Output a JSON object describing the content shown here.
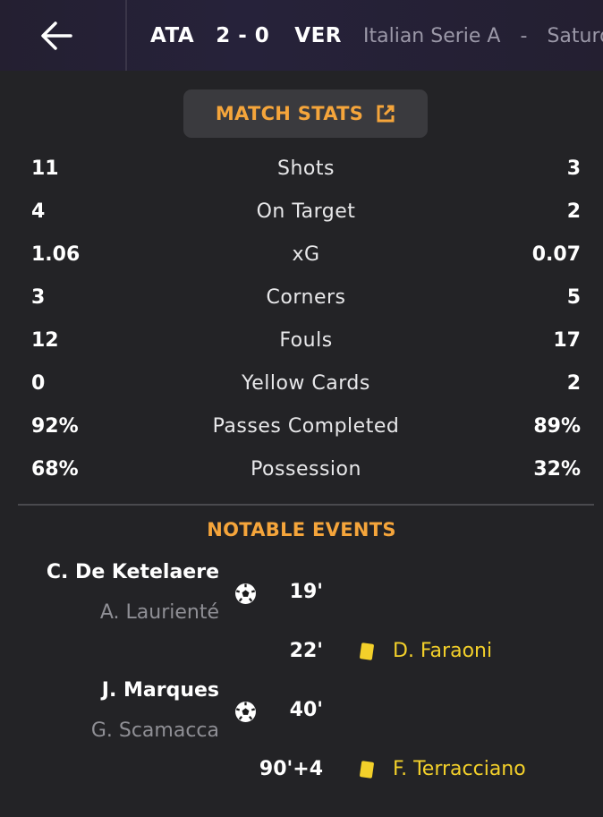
{
  "header": {
    "home_team": "ATA",
    "score": "2 - 0",
    "away_team": "VER",
    "league": "Italian Serie A",
    "separator": "-",
    "date": "Saturday"
  },
  "stats_button_label": "MATCH STATS",
  "stats": [
    {
      "home": "11",
      "label": "Shots",
      "away": "3"
    },
    {
      "home": "4",
      "label": "On Target",
      "away": "2"
    },
    {
      "home": "1.06",
      "label": "xG",
      "away": "0.07"
    },
    {
      "home": "3",
      "label": "Corners",
      "away": "5"
    },
    {
      "home": "12",
      "label": "Fouls",
      "away": "17"
    },
    {
      "home": "0",
      "label": "Yellow Cards",
      "away": "2"
    },
    {
      "home": "92%",
      "label": "Passes Completed",
      "away": "89%"
    },
    {
      "home": "68%",
      "label": "Possession",
      "away": "32%"
    }
  ],
  "events_title": "NOTABLE EVENTS",
  "events": [
    {
      "type": "goal",
      "side": "home",
      "player": "C. De Ketelaere",
      "assist": "A. Laurienté",
      "minute": "19'"
    },
    {
      "type": "yellow-card",
      "side": "away",
      "player": "D. Faraoni",
      "minute": "22'"
    },
    {
      "type": "goal",
      "side": "home",
      "player": "J. Marques",
      "assist": "G. Scamacca",
      "minute": "40'"
    },
    {
      "type": "yellow-card",
      "side": "away",
      "player": "F. Terracciano",
      "minute": "90'+4"
    }
  ],
  "colors": {
    "background": "#232326",
    "accent": "#f5a53b",
    "yellow_card": "#f3d02a",
    "muted_text": "#8f8f95"
  },
  "icons": [
    "back-arrow-icon",
    "external-link-icon",
    "football-icon",
    "yellow-card-icon"
  ]
}
